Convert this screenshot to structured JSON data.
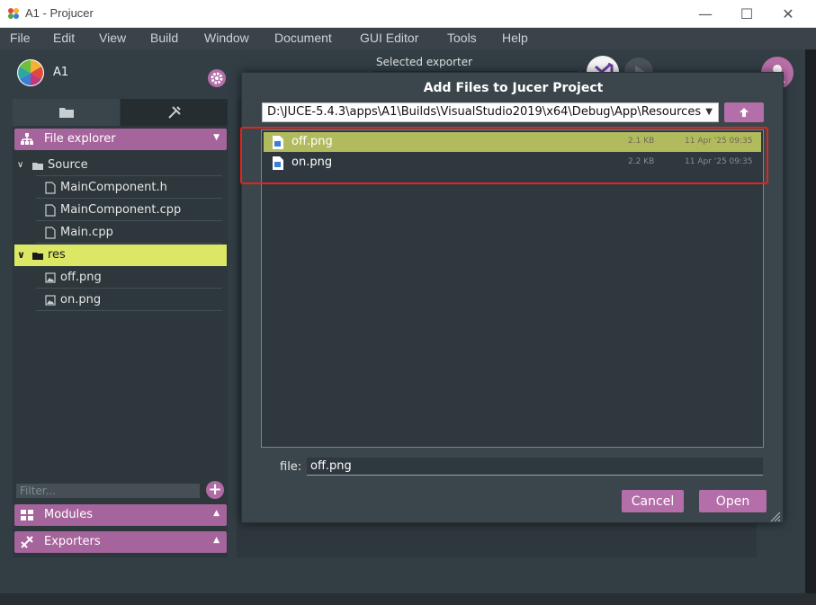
{
  "window": {
    "title": "A1 - Projucer",
    "min_glyph": "—",
    "max_glyph": "☐",
    "close_glyph": "✕"
  },
  "menu": [
    "File",
    "Edit",
    "View",
    "Build",
    "Window",
    "Document",
    "GUI Editor",
    "Tools",
    "Help"
  ],
  "project": {
    "name": "A1",
    "selected_exporter_label": "Selected exporter"
  },
  "sidebar": {
    "file_explorer_label": "File explorer",
    "tree": [
      {
        "label": "Source",
        "kind": "folder",
        "level": 0
      },
      {
        "label": "MainComponent.h",
        "kind": "file",
        "level": 1
      },
      {
        "label": "MainComponent.cpp",
        "kind": "file",
        "level": 1
      },
      {
        "label": "Main.cpp",
        "kind": "file",
        "level": 1
      },
      {
        "label": "res",
        "kind": "folder",
        "level": 0,
        "selected": true
      },
      {
        "label": "off.png",
        "kind": "image",
        "level": 1
      },
      {
        "label": "on.png",
        "kind": "image",
        "level": 1
      }
    ],
    "filter_placeholder": "Filter...",
    "modules_label": "Modules",
    "exporters_label": "Exporters"
  },
  "dialog": {
    "title": "Add Files to Jucer Project",
    "path": "D:\\JUCE-5.4.3\\apps\\A1\\Builds\\VisualStudio2019\\x64\\Debug\\App\\Resources",
    "files": [
      {
        "name": "off.png",
        "size": "2.1 KB",
        "date": "11 Apr '25 09:35",
        "selected": true
      },
      {
        "name": "on.png",
        "size": "2.2 KB",
        "date": "11 Apr '25 09:35",
        "selected": false
      }
    ],
    "file_label": "file:",
    "file_value": "off.png",
    "cancel_label": "Cancel",
    "open_label": "Open"
  },
  "colors": {
    "accent": "#b46ea9",
    "selection_yellow": "#dbe765",
    "list_selection": "#b2ba5e",
    "annotation_red": "#e3231c"
  }
}
